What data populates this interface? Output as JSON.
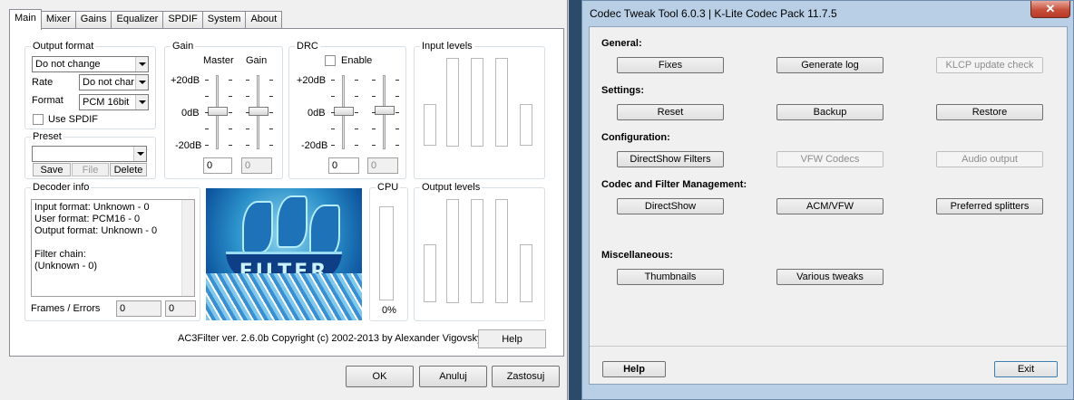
{
  "ac3filter": {
    "tabs": [
      "Main",
      "Mixer",
      "Gains",
      "Equalizer",
      "SPDIF",
      "System",
      "About"
    ],
    "output_format": {
      "title": "Output format",
      "format_value": "Do not change",
      "rate_label": "Rate",
      "rate_value": "Do not char",
      "format_label": "Format",
      "format_select": "PCM 16bit",
      "use_spdif": "Use SPDIF"
    },
    "preset": {
      "title": "Preset",
      "value": "",
      "save": "Save",
      "file": "File",
      "delete": "Delete"
    },
    "gain": {
      "title": "Gain",
      "master": "Master",
      "gain": "Gain",
      "plus20": "+20dB",
      "zero": "0dB",
      "minus20": "-20dB",
      "value1": "0",
      "value2": "0",
      "master_level": 0,
      "gain_level": 0
    },
    "drc": {
      "title": "DRC",
      "enable": "Enable",
      "plus20": "+20dB",
      "zero": "0dB",
      "minus20": "-20dB",
      "value1": "0",
      "value2": "0"
    },
    "input_levels": {
      "title": "Input levels"
    },
    "decoder_info": {
      "title": "Decoder info",
      "lines": [
        "Input format: Unknown - 0",
        "User format: PCM16 - 0",
        "Output format: Unknown - 0",
        "",
        "Filter chain:",
        "(Unknown - 0)"
      ]
    },
    "frames_errors": {
      "label": "Frames / Errors",
      "frames": "0",
      "errors": "0"
    },
    "cpu": {
      "title": "CPU",
      "value": "0%"
    },
    "output_levels": {
      "title": "Output levels"
    },
    "logo_text": "FILTER",
    "copyright": "AC3Filter ver. 2.6.0b Copyright (c) 2002-2013 by Alexander Vigovsky",
    "help": "Help",
    "ok": "OK",
    "cancel": "Anuluj",
    "apply": "Zastosuj"
  },
  "codec_tweak": {
    "title": "Codec Tweak Tool 6.0.3   |   K-Lite Codec Pack 11.7.5",
    "close_icon": "close-icon",
    "sections": [
      {
        "label": "General:",
        "buttons": [
          {
            "label": "Fixes",
            "enabled": true
          },
          {
            "label": "Generate log",
            "enabled": true
          },
          {
            "label": "KLCP update check",
            "enabled": false
          }
        ]
      },
      {
        "label": "Settings:",
        "buttons": [
          {
            "label": "Reset",
            "enabled": true
          },
          {
            "label": "Backup",
            "enabled": true
          },
          {
            "label": "Restore",
            "enabled": true
          }
        ]
      },
      {
        "label": "Configuration:",
        "buttons": [
          {
            "label": "DirectShow Filters",
            "enabled": true
          },
          {
            "label": "VFW Codecs",
            "enabled": false
          },
          {
            "label": "Audio output",
            "enabled": false
          }
        ]
      },
      {
        "label": "Codec and Filter Management:",
        "buttons": [
          {
            "label": "DirectShow",
            "enabled": true
          },
          {
            "label": "ACM/VFW",
            "enabled": true
          },
          {
            "label": "Preferred splitters",
            "enabled": true
          }
        ]
      },
      {
        "label": "Miscellaneous:",
        "buttons": [
          {
            "label": "Thumbnails",
            "enabled": true
          },
          {
            "label": "Various tweaks",
            "enabled": true
          }
        ]
      }
    ],
    "help": "Help",
    "exit": "Exit"
  }
}
